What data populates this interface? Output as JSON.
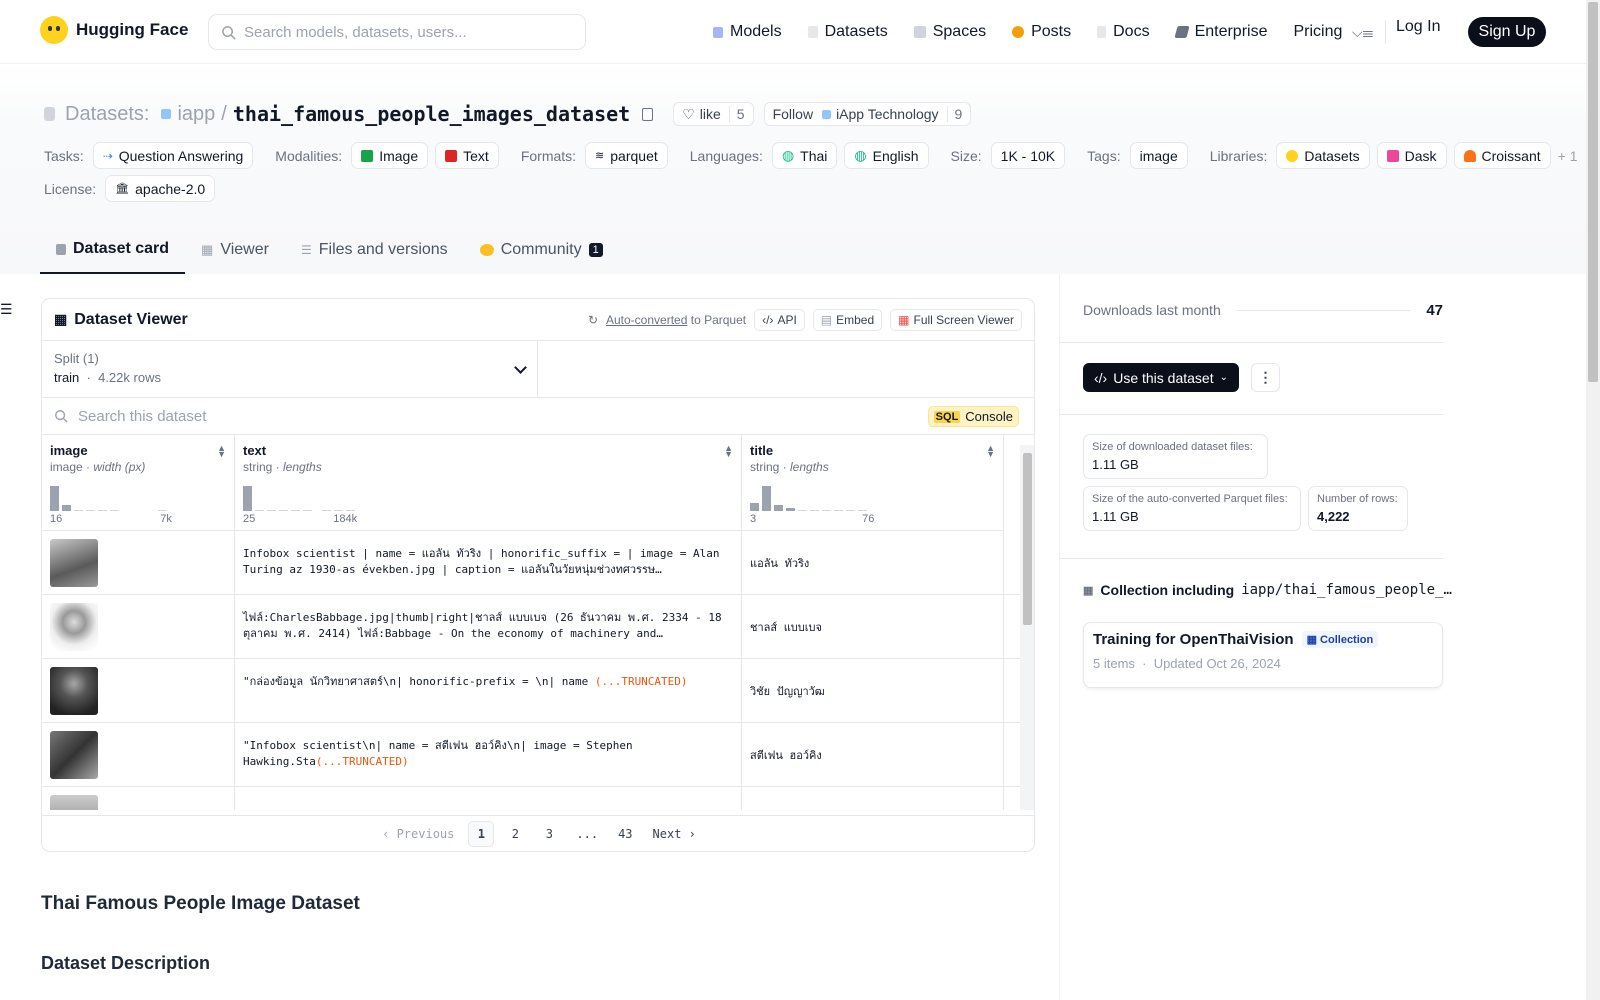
{
  "nav": {
    "brand": "Hugging Face",
    "search_placeholder": "Search models, datasets, users...",
    "links": [
      "Models",
      "Datasets",
      "Spaces",
      "Posts",
      "Docs",
      "Enterprise",
      "Pricing"
    ],
    "login": "Log In",
    "signup": "Sign Up"
  },
  "header": {
    "section": "Datasets:",
    "owner": "iapp",
    "slash": "/",
    "repo": "thai_famous_people_images_dataset",
    "like_label": "like",
    "like_count": "5",
    "follow_label": "Follow",
    "follow_org": "iApp Technology",
    "follow_count": "9"
  },
  "tags": {
    "tasks_label": "Tasks:",
    "task": "Question Answering",
    "modalities_label": "Modalities:",
    "modalities": [
      "Image",
      "Text"
    ],
    "formats_label": "Formats:",
    "format": "parquet",
    "languages_label": "Languages:",
    "languages": [
      "Thai",
      "English"
    ],
    "size_label": "Size:",
    "size": "1K - 10K",
    "tags_label": "Tags:",
    "tag": "image",
    "libraries_label": "Libraries:",
    "libraries": [
      "Datasets",
      "Dask",
      "Croissant"
    ],
    "more": "+ 1",
    "license_label": "License:",
    "license": "apache-2.0"
  },
  "tabs": [
    "Dataset card",
    "Viewer",
    "Files and versions",
    "Community"
  ],
  "community_count": "1",
  "viewer": {
    "title": "Dataset Viewer",
    "auto_link": "Auto-converted",
    "auto_rest": "to Parquet",
    "api": "API",
    "embed": "Embed",
    "fullscreen": "Full Screen Viewer",
    "split_label": "Split (1)",
    "split_name": "train",
    "split_rows": "4.22k rows",
    "search_placeholder": "Search this dataset",
    "sql": "SQL",
    "console": "Console",
    "columns": [
      {
        "name": "image",
        "type": "image",
        "meta": "width (px)",
        "min": "16",
        "max": "7k"
      },
      {
        "name": "text",
        "type": "string",
        "meta": "lengths",
        "min": "25",
        "max": "184k"
      },
      {
        "name": "title",
        "type": "string",
        "meta": "lengths",
        "min": "3",
        "max": "76"
      }
    ],
    "rows": [
      {
        "text": "Infobox scientist | name = แอลัน ทัวริง | honorific_suffix = | image = Alan Turing az 1930-as években.jpg | caption = แอลันในวัยหนุ่มช่วงทศวรรษ…",
        "trunc": "",
        "title": "แอลัน ทัวริง"
      },
      {
        "text": "ไฟล์:CharlesBabbage.jpg|thumb|right|ชาลส์ แบบเบจ (26 ธันวาคม พ.ศ. 2334 - 18 ตุลาคม พ.ศ. 2414) ไฟล์:Babbage - On the economy of machinery and…",
        "trunc": "",
        "title": "ชาลส์ แบบเบจ"
      },
      {
        "text": "\"กล่องข้อมูล นักวิทยาศาสตร์\\n| honorific-prefix = \\n| name ",
        "trunc": "(...TRUNCATED)",
        "title": "วิชัย ปัญญาวัฒ"
      },
      {
        "text": "\"Infobox scientist\\n| name = สตีเฟน ฮอว์คิง\\n| image = Stephen Hawking.Sta",
        "trunc": "(...TRUNCATED)",
        "title": "สตีเฟน ฮอว์คิง"
      }
    ],
    "pager": {
      "prev": "Previous",
      "pages": [
        "1",
        "2",
        "3",
        "...",
        "43"
      ],
      "next": "Next"
    }
  },
  "card": {
    "h1": "Thai Famous People Image Dataset",
    "h2": "Dataset Description"
  },
  "sidebar": {
    "downloads_label": "Downloads last month",
    "downloads": "47",
    "use_button": "Use this dataset",
    "size_dl_label": "Size of downloaded dataset files:",
    "size_dl": "1.11 GB",
    "size_pq_label": "Size of the auto-converted Parquet files:",
    "size_pq": "1.11 GB",
    "rows_label": "Number of rows:",
    "rows": "4,222",
    "collection_label": "Collection including",
    "collection_repo": "iapp/thai_famous_people_…",
    "collection_title": "Training for OpenThaiVision",
    "collection_badge": "Collection",
    "collection_items": "5 items",
    "collection_updated": "Updated Oct 26, 2024"
  },
  "colors": {
    "accent": "#0b0f19",
    "brand": "#ffd21e",
    "truncated": "#ea580c"
  }
}
